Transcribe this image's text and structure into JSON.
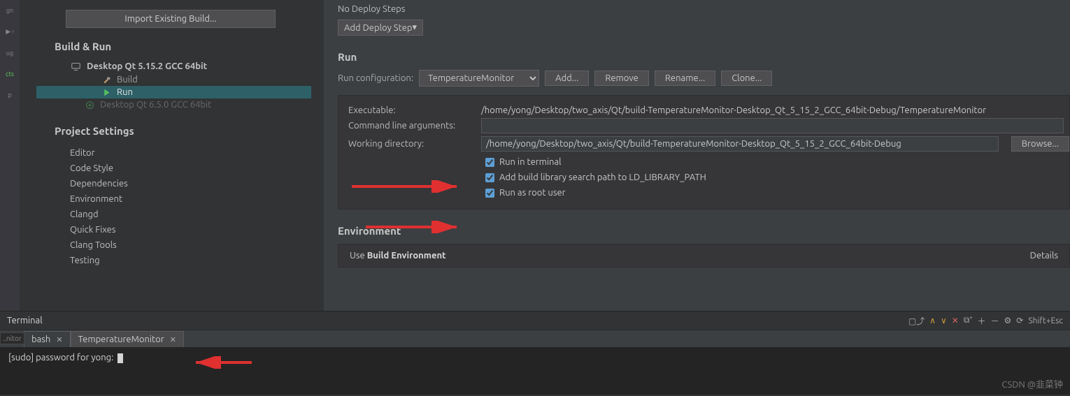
{
  "sidebar_icons": [
    "gn",
    "▶ ›",
    "ug",
    "cts",
    "p"
  ],
  "import_btn": "Import Existing Build...",
  "build_run_title": "Build & Run",
  "kit_active": "Desktop Qt 5.15.2 GCC 64bit",
  "kit_build": "Build",
  "kit_run": "Run",
  "kit_inactive": "Desktop Qt 6.5.0 GCC 64bit",
  "project_settings_title": "Project Settings",
  "project_items": [
    "Editor",
    "Code Style",
    "Dependencies",
    "Environment",
    "Clangd",
    "Quick Fixes",
    "Clang Tools",
    "Testing"
  ],
  "no_deploy": "No Deploy Steps",
  "add_deploy": "Add Deploy Step",
  "run_title": "Run",
  "run_config_label": "Run configuration:",
  "run_config_value": "TemperatureMonitor",
  "buttons": {
    "add": "Add...",
    "remove": "Remove",
    "rename": "Rename...",
    "clone": "Clone..."
  },
  "exec_label": "Executable:",
  "exec_value": "/home/yong/Desktop/two_axis/Qt/build-TemperatureMonitor-Desktop_Qt_5_15_2_GCC_64bit-Debug/TemperatureMonitor",
  "args_label": "Command line arguments:",
  "args_value": "",
  "wd_label": "Working directory:",
  "wd_value": "/home/yong/Desktop/two_axis/Qt/build-TemperatureMonitor-Desktop_Qt_5_15_2_GCC_64bit-Debug",
  "browse": "Browse...",
  "chk_terminal": "Run in terminal",
  "chk_ldpath": "Add build library search path to LD_LIBRARY_PATH",
  "chk_root": "Run as root user",
  "env_title": "Environment",
  "env_use": "Use ",
  "env_bold": "Build Environment",
  "details": "Details",
  "terminal_title": "Terminal",
  "shift_esc": "Shift+Esc",
  "tab_bash": "bash",
  "tab_proc": "TemperatureMonitor",
  "term_text": "[sudo] password for yong: ",
  "left_tab": "..nitor",
  "watermark": "CSDN @韭菜钟"
}
